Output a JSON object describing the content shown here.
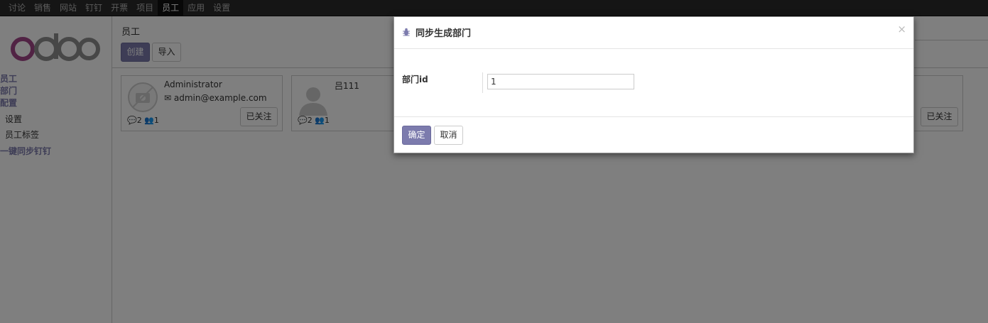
{
  "topnav": {
    "items": [
      "讨论",
      "销售",
      "网站",
      "钉钉",
      "开票",
      "项目",
      "员工",
      "应用",
      "设置"
    ],
    "active_index": 6
  },
  "sidebar": {
    "logo_text": "odoo",
    "groups": [
      {
        "label": "员工"
      },
      {
        "label": "部门"
      },
      {
        "label": "配置",
        "sub": [
          "设置",
          "员工标签"
        ]
      },
      {
        "label": "一键同步钉钉"
      }
    ]
  },
  "main": {
    "breadcrumb": "员工",
    "create_label": "创建",
    "import_label": "导入",
    "cards": [
      {
        "name": "Administrator",
        "email": "admin@example.com",
        "messages": "2",
        "followers": "1",
        "follow_label": "已关注"
      },
      {
        "name": "吕111",
        "email": "",
        "messages": "2",
        "followers": "1",
        "follow_label": ""
      },
      {
        "name": "",
        "email": "",
        "messages": "",
        "followers": "",
        "follow_label": "已关注"
      }
    ]
  },
  "dialog": {
    "title": "同步生成部门",
    "close_glyph": "×",
    "field_label": "部门id",
    "field_value": "1",
    "confirm_label": "确定",
    "cancel_label": "取消"
  },
  "colors": {
    "accent": "#7c7bad",
    "topbar": "#2b2b2b"
  }
}
